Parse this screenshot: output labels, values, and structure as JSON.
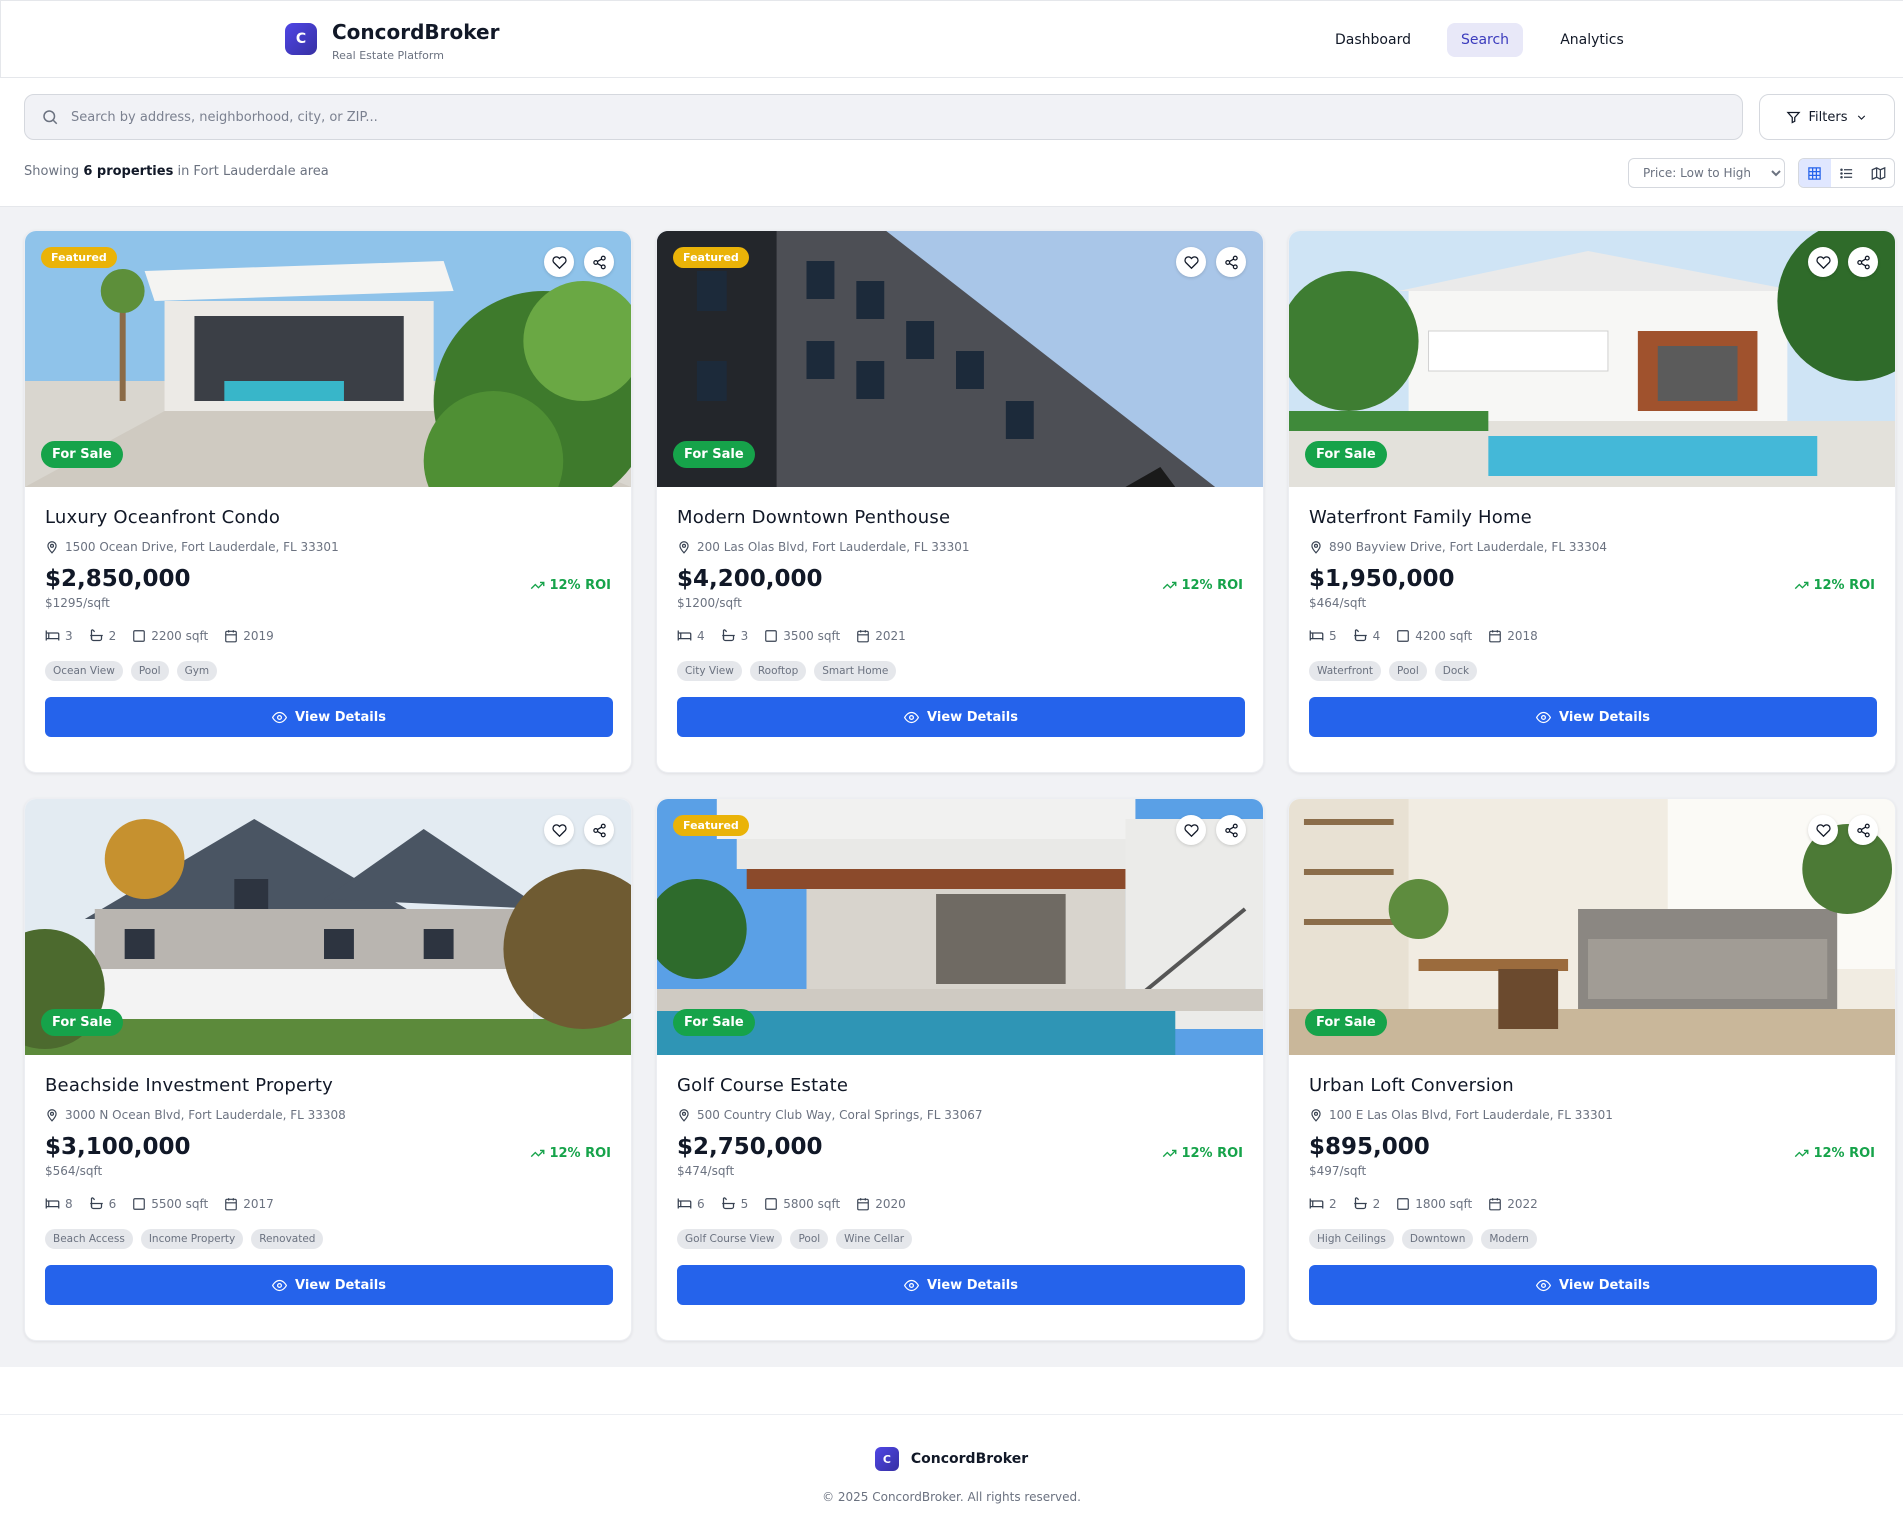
{
  "brand": {
    "logo_letter": "C",
    "name": "ConcordBroker",
    "subtitle": "Real Estate Platform"
  },
  "nav": {
    "items": [
      {
        "label": "Dashboard"
      },
      {
        "label": "Search",
        "active": true
      },
      {
        "label": "Analytics"
      }
    ]
  },
  "search": {
    "placeholder": "Search by address, neighborhood, city, or ZIP...",
    "value": ""
  },
  "filters": {
    "label": "Filters"
  },
  "results": {
    "prefix": "Showing",
    "count_text": "6 properties",
    "suffix": "in Fort Lauderdale area"
  },
  "sort": {
    "selected": "Price: Low to High"
  },
  "view_modes": [
    {
      "icon": "grid-icon",
      "active": true
    },
    {
      "icon": "list-icon",
      "active": false
    },
    {
      "icon": "map-icon",
      "active": false
    }
  ],
  "colors": {
    "primary": "#2563eb",
    "brand": "#4338ca",
    "success": "#16a34a",
    "featured": "#eab308",
    "nav_active_bg": "#e8e8f8"
  },
  "cards": [
    {
      "featured": true,
      "featured_label": "Featured",
      "status": "For Sale",
      "title": "Luxury Oceanfront Condo",
      "address": "1500 Ocean Drive, Fort Lauderdale, FL 33301",
      "price": "$2,850,000",
      "price_per_sqft": "$1295/sqft",
      "roi": "12% ROI",
      "beds": "3",
      "baths": "2",
      "sqft": "2200 sqft",
      "year": "2019",
      "tags": [
        "Ocean View",
        "Pool",
        "Gym"
      ],
      "button": "View Details",
      "image_theme": "modern-villa"
    },
    {
      "featured": true,
      "featured_label": "Featured",
      "status": "For Sale",
      "title": "Modern Downtown Penthouse",
      "address": "200 Las Olas Blvd, Fort Lauderdale, FL 33301",
      "price": "$4,200,000",
      "price_per_sqft": "$1200/sqft",
      "roi": "12% ROI",
      "beds": "4",
      "baths": "3",
      "sqft": "3500 sqft",
      "year": "2021",
      "tags": [
        "City View",
        "Rooftop",
        "Smart Home"
      ],
      "button": "View Details",
      "image_theme": "tower"
    },
    {
      "featured": false,
      "featured_label": "",
      "status": "For Sale",
      "title": "Waterfront Family Home",
      "address": "890 Bayview Drive, Fort Lauderdale, FL 33304",
      "price": "$1,950,000",
      "price_per_sqft": "$464/sqft",
      "roi": "12% ROI",
      "beds": "5",
      "baths": "4",
      "sqft": "4200 sqft",
      "year": "2018",
      "tags": [
        "Waterfront",
        "Pool",
        "Dock"
      ],
      "button": "View Details",
      "image_theme": "pool-house"
    },
    {
      "featured": false,
      "featured_label": "",
      "status": "For Sale",
      "title": "Beachside Investment Property",
      "address": "3000 N Ocean Blvd, Fort Lauderdale, FL 33308",
      "price": "$3,100,000",
      "price_per_sqft": "$564/sqft",
      "roi": "12% ROI",
      "beds": "8",
      "baths": "6",
      "sqft": "5500 sqft",
      "year": "2017",
      "tags": [
        "Beach Access",
        "Income Property",
        "Renovated"
      ],
      "button": "View Details",
      "image_theme": "victorian"
    },
    {
      "featured": true,
      "featured_label": "Featured",
      "status": "For Sale",
      "title": "Golf Course Estate",
      "address": "500 Country Club Way, Coral Springs, FL 33067",
      "price": "$2,750,000",
      "price_per_sqft": "$474/sqft",
      "roi": "12% ROI",
      "beds": "6",
      "baths": "5",
      "sqft": "5800 sqft",
      "year": "2020",
      "tags": [
        "Golf Course View",
        "Pool",
        "Wine Cellar"
      ],
      "button": "View Details",
      "image_theme": "modern-pool"
    },
    {
      "featured": false,
      "featured_label": "",
      "status": "For Sale",
      "title": "Urban Loft Conversion",
      "address": "100 E Las Olas Blvd, Fort Lauderdale, FL 33301",
      "price": "$895,000",
      "price_per_sqft": "$497/sqft",
      "roi": "12% ROI",
      "beds": "2",
      "baths": "2",
      "sqft": "1800 sqft",
      "year": "2022",
      "tags": [
        "High Ceilings",
        "Downtown",
        "Modern"
      ],
      "button": "View Details",
      "image_theme": "loft"
    }
  ],
  "footer": {
    "logo_letter": "C",
    "name": "ConcordBroker",
    "copyright": "© 2025 ConcordBroker. All rights reserved."
  }
}
